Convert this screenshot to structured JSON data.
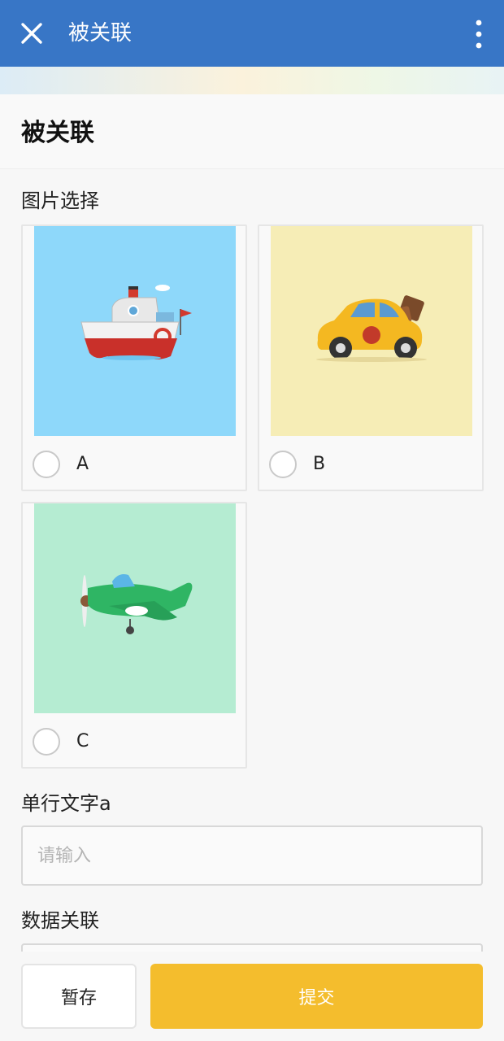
{
  "header": {
    "title": "被关联",
    "close_icon": "close-icon",
    "more_icon": "more-vertical-icon",
    "color": "#3876c6"
  },
  "form": {
    "title": "被关联"
  },
  "image_select": {
    "label": "图片选择",
    "options": [
      {
        "label": "A",
        "image": "cartoon-boat",
        "bg_color": "#8ed8fa",
        "selected": false
      },
      {
        "label": "B",
        "image": "cartoon-car",
        "bg_color": "#f6edb6",
        "selected": false
      },
      {
        "label": "C",
        "image": "cartoon-airplane",
        "bg_color": "#b5ecd2",
        "selected": false
      }
    ]
  },
  "single_line_text": {
    "label": "单行文字a",
    "placeholder": "请输入",
    "value": ""
  },
  "data_relation": {
    "label": "数据关联"
  },
  "footer": {
    "save_label": "暂存",
    "submit_label": "提交",
    "submit_color": "#f4bd2d"
  }
}
